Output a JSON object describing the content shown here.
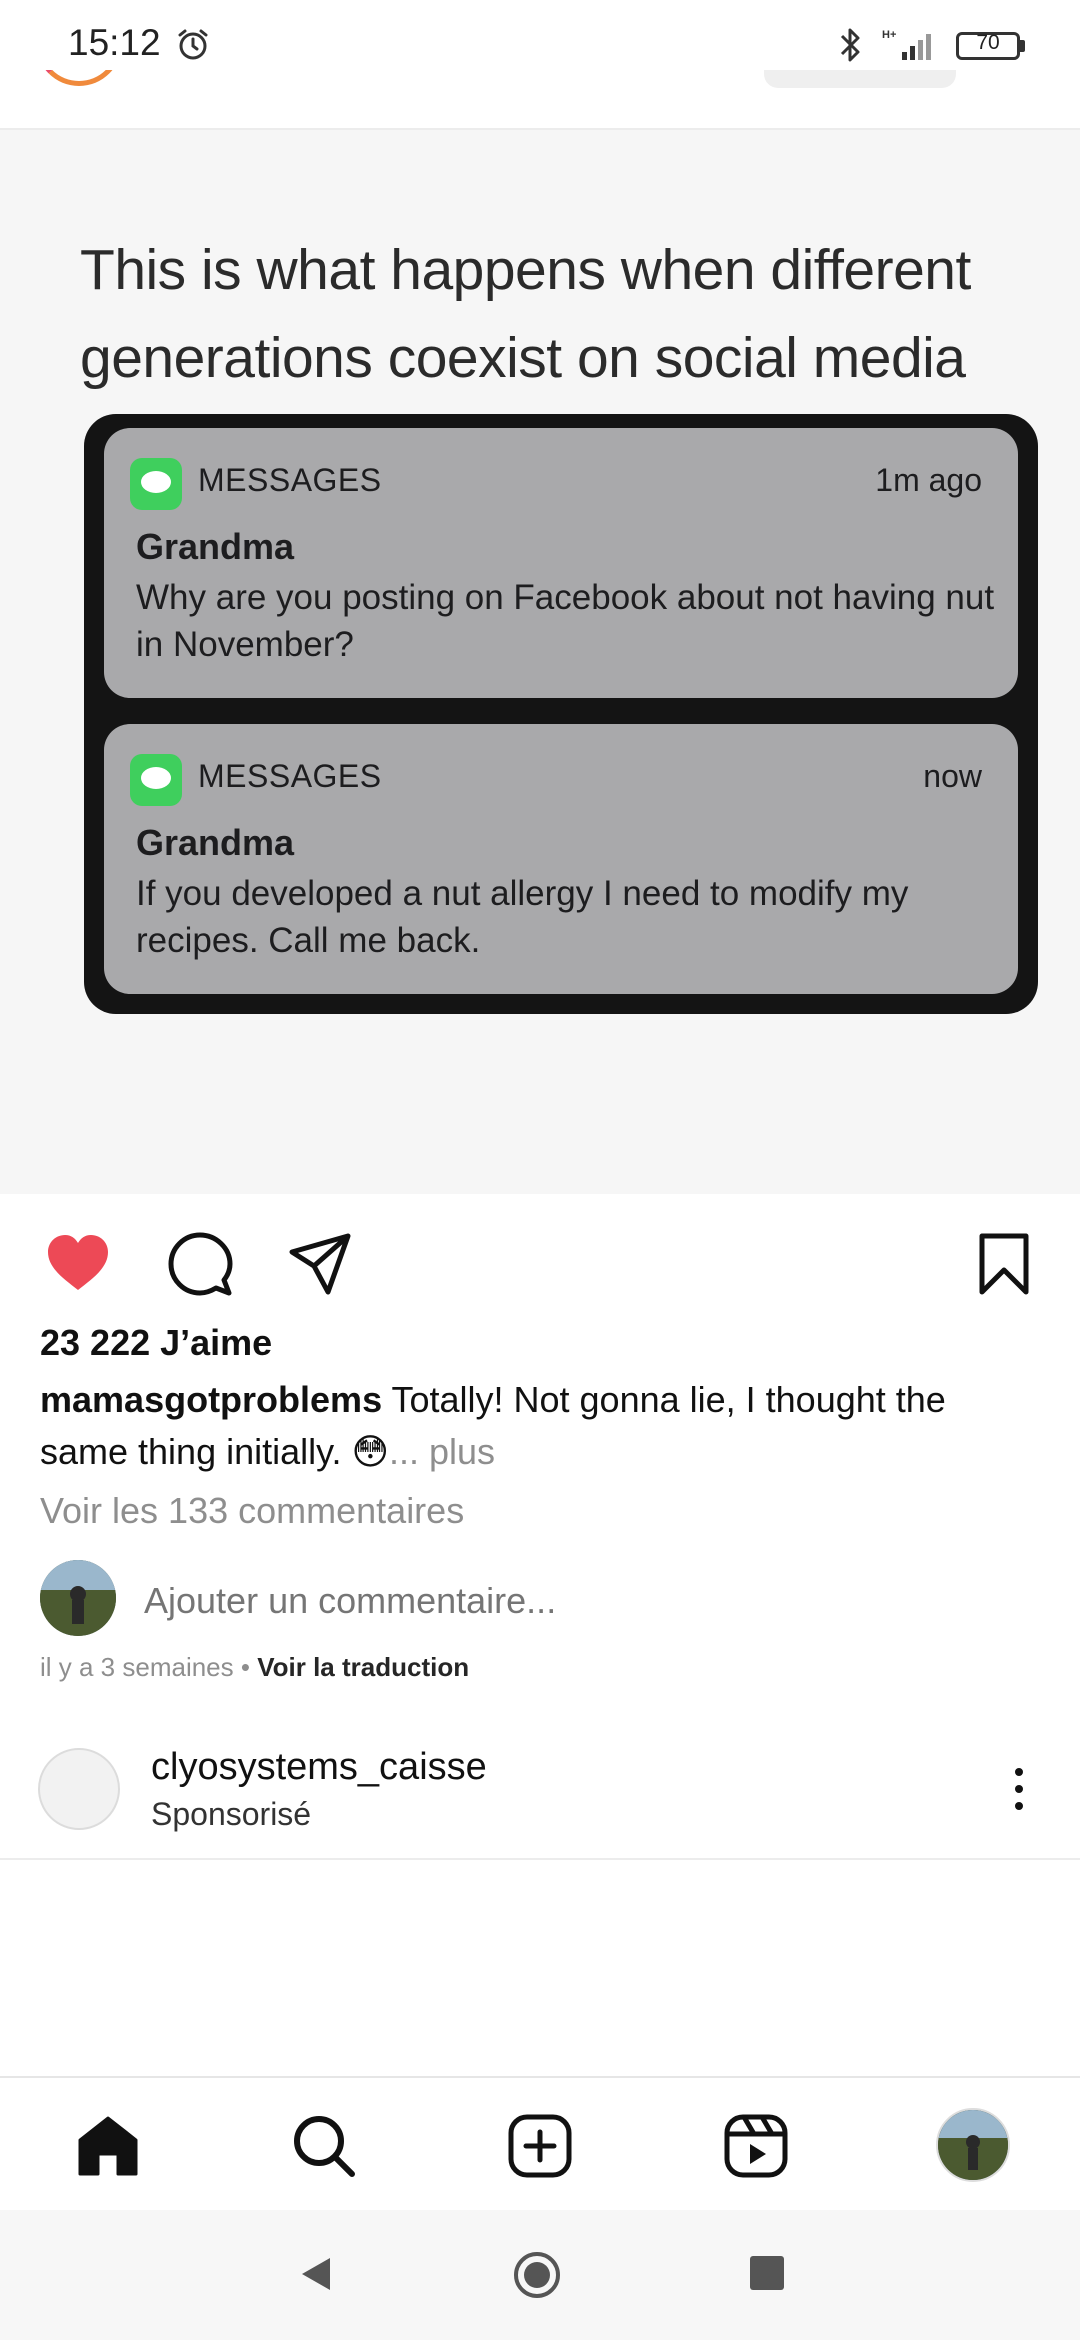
{
  "status_bar": {
    "time": "15:12",
    "network": "H+",
    "battery": "70"
  },
  "post": {
    "image": {
      "caption_text": "This is what happens when different generations coexist on social media",
      "notifications": [
        {
          "app_name": "MESSAGES",
          "time": "1m ago",
          "sender": "Grandma",
          "body": "Why are you posting on Facebook about not having nut in November?"
        },
        {
          "app_name": "MESSAGES",
          "time": "now",
          "sender": "Grandma",
          "body": "If you developed a nut allergy I need to modify my recipes. Call me back."
        }
      ]
    },
    "liked": true,
    "likes_text": "23 222 J’aime",
    "caption": {
      "username": "mamasgotproblems",
      "text": "Totally! Not gonna lie, I thought the same thing initially. 😳",
      "more": "... plus"
    },
    "view_comments": "Voir les 133 commentaires",
    "add_comment_placeholder": "Ajouter un commentaire...",
    "timestamp": "il y a 3 semaines",
    "separator": " • ",
    "translate": "Voir la traduction"
  },
  "sponsored_post": {
    "username": "clyosystems_caisse",
    "label": "Sponsorisé"
  },
  "colors": {
    "like_red": "#ed4956",
    "notification_gray": "#a9a9ab",
    "messages_green": "#3fcf5d"
  }
}
